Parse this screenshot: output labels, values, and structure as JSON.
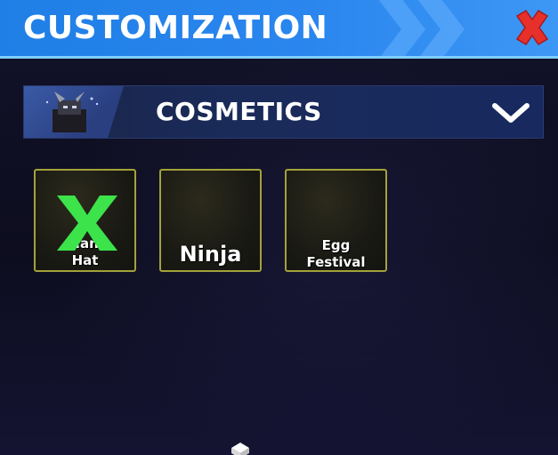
{
  "header": {
    "title": "CUSTOMIZATION",
    "close_icon": "close-x-icon",
    "accent_color": "#2a86ee",
    "close_color": "#e8302b"
  },
  "section": {
    "title": "COSMETICS",
    "thumbnail_icon": "character-thumbnail-icon",
    "toggle_icon": "chevron-down-icon"
  },
  "items": [
    {
      "label_line1": "...ant",
      "label_line2": "Hat",
      "overlay_icon": "green-x-icon",
      "overlay_color": "#3ce34a"
    },
    {
      "label": "Ninja"
    },
    {
      "label_line1": "Egg",
      "label_line2": "Festival"
    }
  ],
  "frame_color": "#a3a23a"
}
